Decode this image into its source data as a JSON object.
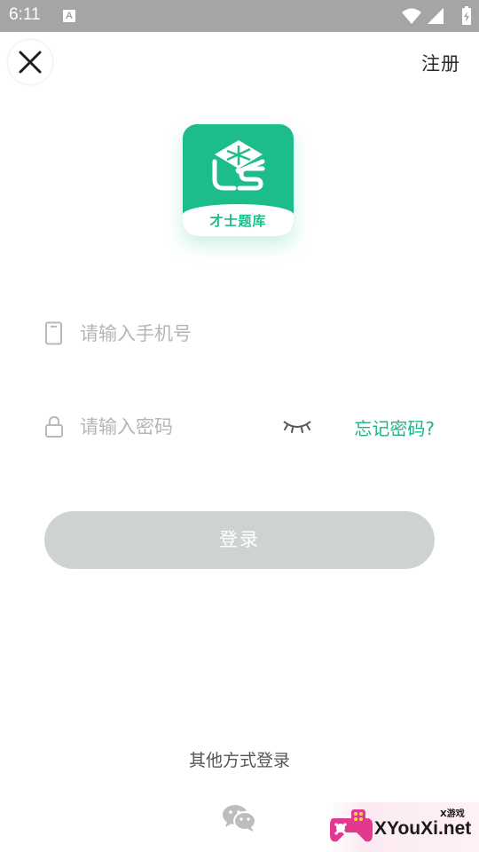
{
  "status_bar": {
    "time": "6:11",
    "notification_icon": "A",
    "icons": [
      "wifi-icon",
      "signal-icon",
      "battery-icon"
    ]
  },
  "header": {
    "close_icon": "close-icon",
    "register_label": "注册"
  },
  "logo": {
    "text": "才士题库",
    "color": "#1dbc8b"
  },
  "form": {
    "phone_placeholder": "请输入手机号",
    "phone_value": "",
    "password_placeholder": "请输入密码",
    "password_value": "",
    "forgot_label": "忘记密码?",
    "login_label": "登录"
  },
  "footer": {
    "other_login_label": "其他方式登录",
    "wechat_icon": "wechat-icon"
  },
  "watermark": {
    "text": "XYouXi.net",
    "small_text": "X游戏"
  },
  "colors": {
    "accent": "#1fb48a",
    "status_bar": "#a5a5a5",
    "button_disabled": "#ced3d1"
  }
}
